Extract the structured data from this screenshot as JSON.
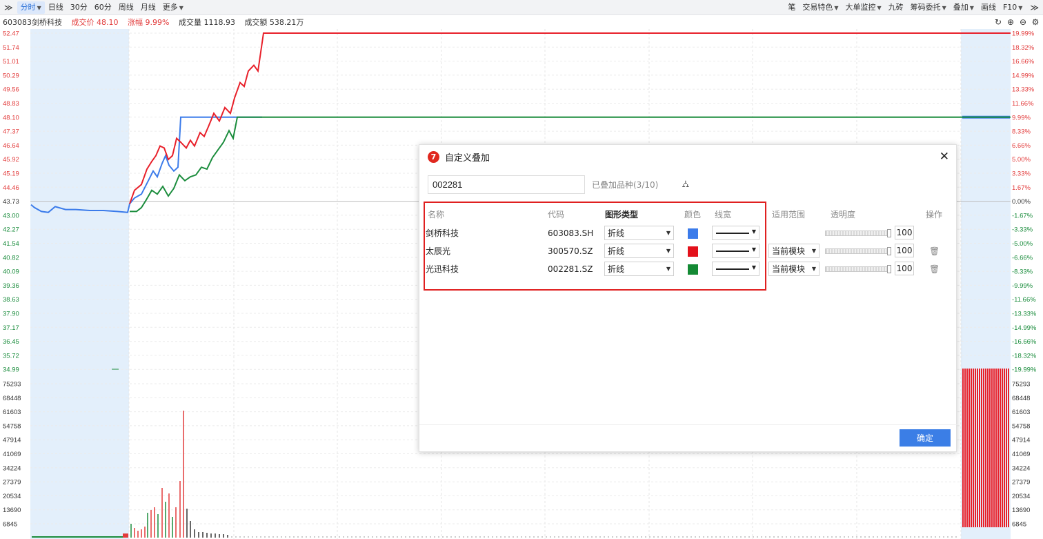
{
  "toolbar": {
    "left": [
      {
        "name": "collapse-left-button",
        "label": "≫",
        "active": false
      },
      {
        "name": "tab-intraday",
        "label": "分时",
        "active": true,
        "caret": true
      },
      {
        "name": "tab-daily",
        "label": "日线",
        "active": false
      },
      {
        "name": "tab-30min",
        "label": "30分",
        "active": false
      },
      {
        "name": "tab-60min",
        "label": "60分",
        "active": false
      },
      {
        "name": "tab-weekly",
        "label": "周线",
        "active": false
      },
      {
        "name": "tab-monthly",
        "label": "月线",
        "active": false
      },
      {
        "name": "more-menu",
        "label": "更多",
        "active": false,
        "caret": true
      }
    ],
    "right": [
      {
        "name": "pen-button",
        "label": "笔",
        "caret": false
      },
      {
        "name": "trade-features-menu",
        "label": "交易特色",
        "caret": true
      },
      {
        "name": "big-order-menu",
        "label": "大单监控",
        "caret": true
      },
      {
        "name": "nine-bricks-button",
        "label": "九砖",
        "caret": false
      },
      {
        "name": "chip-order-menu",
        "label": "筹码委托",
        "caret": true
      },
      {
        "name": "overlay-menu",
        "label": "叠加",
        "caret": true
      },
      {
        "name": "draw-line-button",
        "label": "画线",
        "caret": false
      },
      {
        "name": "f10-menu",
        "label": "F10",
        "caret": true
      },
      {
        "name": "collapse-right-button",
        "label": "≫",
        "caret": false
      }
    ]
  },
  "info": {
    "stock": "603083剑桥科技",
    "price_label": "成交价 48.10",
    "change_label": "涨幅 9.99%",
    "volume_label": "成交量 1118.93",
    "amount_label": "成交额 538.21万"
  },
  "axis": {
    "price_left": [
      "52.47",
      "51.74",
      "51.01",
      "50.29",
      "49.56",
      "48.83",
      "48.10",
      "47.37",
      "46.64",
      "45.92",
      "45.19",
      "44.46",
      "43.73",
      "43.00",
      "42.27",
      "41.54",
      "40.82",
      "40.09",
      "39.36",
      "38.63",
      "37.90",
      "37.17",
      "36.45",
      "35.72",
      "34.99"
    ],
    "pct_right": [
      "19.99%",
      "18.32%",
      "16.66%",
      "14.99%",
      "13.33%",
      "11.66%",
      "9.99%",
      "8.33%",
      "6.66%",
      "5.00%",
      "3.33%",
      "1.67%",
      "0.00%",
      "-1.67%",
      "-3.33%",
      "-5.00%",
      "-6.66%",
      "-8.33%",
      "-9.99%",
      "-11.66%",
      "-13.33%",
      "-14.99%",
      "-16.66%",
      "-18.32%",
      "-19.99%"
    ],
    "vol": [
      "75293",
      "68448",
      "61603",
      "54758",
      "47914",
      "41069",
      "34224",
      "27379",
      "20534",
      "13690",
      "6845"
    ]
  },
  "colors": {
    "up": "#e23b3b",
    "down": "#1a8c3c",
    "blue": "#3b7bea",
    "accent": "#3b7ee6"
  },
  "dialog": {
    "title": "自定义叠加",
    "search_value": "002281",
    "count": "已叠加品种(3/10)",
    "headers": {
      "name": "名称",
      "code": "代码",
      "type": "图形类型",
      "color": "颜色",
      "width": "线宽",
      "scope": "适用范围",
      "opacity": "透明度",
      "op": "操作"
    },
    "rows": [
      {
        "name": "剑桥科技",
        "code": "603083.SH",
        "type": "折线",
        "color": "#3b7bea",
        "scope": "",
        "opacity": "100",
        "deletable": false
      },
      {
        "name": "太辰光",
        "code": "300570.SZ",
        "type": "折线",
        "color": "#e3111b",
        "scope": "当前模块",
        "opacity": "100",
        "deletable": true
      },
      {
        "name": "光迅科技",
        "code": "002281.SZ",
        "type": "折线",
        "color": "#148a34",
        "scope": "当前模块",
        "opacity": "100",
        "deletable": true
      }
    ],
    "ok_label": "确定"
  }
}
